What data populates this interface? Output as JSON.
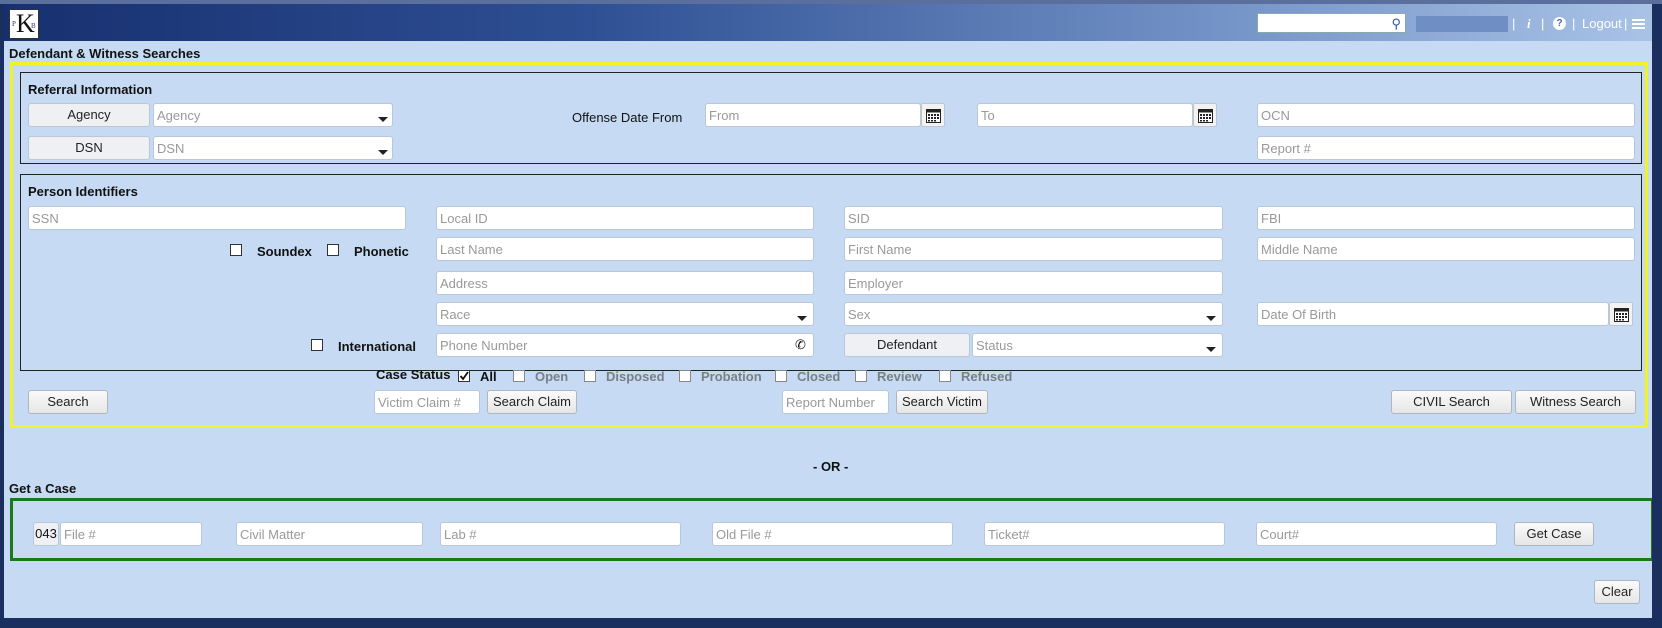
{
  "header": {
    "logo_letters": {
      "p": "P",
      "k": "K",
      "b": "B"
    },
    "search_placeholder": "",
    "nav": [
      "|",
      "i",
      "|",
      "?",
      "|",
      "Logout",
      "|"
    ]
  },
  "page_title": "Defendant & Witness Searches",
  "referral": {
    "title": "Referral Information",
    "agency_label": "Agency",
    "agency_placeholder": "Agency",
    "dsn_label": "DSN",
    "dsn_placeholder": "DSN",
    "offense_date_label": "Offense Date From",
    "from_placeholder": "From",
    "to_placeholder": "To",
    "ocn_placeholder": "OCN",
    "report_placeholder": "Report #"
  },
  "person": {
    "title": "Person Identifiers",
    "ssn": "SSN",
    "local_id": "Local ID",
    "sid": "SID",
    "fbi": "FBI",
    "soundex": "Soundex",
    "phonetic": "Phonetic",
    "last_name": "Last Name",
    "first_name": "First Name",
    "middle_name": "Middle Name",
    "address": "Address",
    "employer": "Employer",
    "race": "Race",
    "sex": "Sex",
    "dob": "Date Of Birth",
    "international": "International",
    "phone": "Phone Number",
    "defendant": "Defendant",
    "status": "Status"
  },
  "case_status": {
    "label": "Case Status",
    "options": [
      {
        "label": "All",
        "checked": true
      },
      {
        "label": "Open",
        "checked": false
      },
      {
        "label": "Disposed",
        "checked": false
      },
      {
        "label": "Probation",
        "checked": false
      },
      {
        "label": "Closed",
        "checked": false
      },
      {
        "label": "Review",
        "checked": false
      },
      {
        "label": "Refused",
        "checked": false
      }
    ]
  },
  "actions": {
    "search": "Search",
    "victim_claim_placeholder": "Victim Claim #",
    "search_claim": "Search Claim",
    "report_number_placeholder": "Report Number",
    "search_victim": "Search Victim",
    "civil_search": "CIVIL Search",
    "witness_search": "Witness Search"
  },
  "or_label": "- OR -",
  "get_case": {
    "title": "Get a Case",
    "prefix": "043",
    "file_placeholder": "File #",
    "civil_matter_placeholder": "Civil Matter",
    "lab_placeholder": "Lab #",
    "old_file_placeholder": "Old File #",
    "ticket_placeholder": "Ticket#",
    "court_placeholder": "Court#",
    "get_case_button": "Get Case"
  },
  "clear": "Clear",
  "colors": {
    "highlight_border": "#f2f229",
    "case_border": "#1a7a1a",
    "background": "#c6dbf3"
  }
}
